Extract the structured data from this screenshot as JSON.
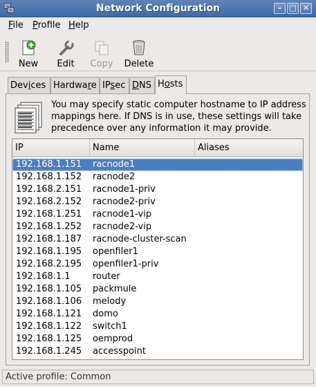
{
  "window": {
    "title": "Network Configuration"
  },
  "menu": {
    "file": "File",
    "profile": "Profile",
    "help": "Help"
  },
  "toolbar": {
    "new": "New",
    "edit": "Edit",
    "copy": "Copy",
    "delete": "Delete"
  },
  "tabs": [
    {
      "label": "Devices",
      "active": false
    },
    {
      "label": "Hardware",
      "active": false
    },
    {
      "label": "IPsec",
      "active": false
    },
    {
      "label": "DNS",
      "active": false
    },
    {
      "label": "Hosts",
      "active": true
    }
  ],
  "info_text": "You may specify static computer hostname to IP address mappings here.  If DNS is in use, these settings will take precedence over any information it may provide.",
  "table": {
    "columns": {
      "ip": "IP",
      "name": "Name",
      "aliases": "Aliases"
    },
    "rows": [
      {
        "ip": "192.168.1.151",
        "name": "racnode1",
        "aliases": "",
        "selected": true
      },
      {
        "ip": "192.168.1.152",
        "name": "racnode2",
        "aliases": ""
      },
      {
        "ip": "192.168.2.151",
        "name": "racnode1-priv",
        "aliases": ""
      },
      {
        "ip": "192.168.2.152",
        "name": "racnode2-priv",
        "aliases": ""
      },
      {
        "ip": "192.168.1.251",
        "name": "racnode1-vip",
        "aliases": ""
      },
      {
        "ip": "192.168.1.252",
        "name": "racnode2-vip",
        "aliases": ""
      },
      {
        "ip": "192.168.1.187",
        "name": "racnode-cluster-scan",
        "aliases": ""
      },
      {
        "ip": "192.168.1.195",
        "name": "openfiler1",
        "aliases": ""
      },
      {
        "ip": "192.168.2.195",
        "name": "openfiler1-priv",
        "aliases": ""
      },
      {
        "ip": "192.168.1.1",
        "name": "router",
        "aliases": ""
      },
      {
        "ip": "192.168.1.105",
        "name": "packmule",
        "aliases": ""
      },
      {
        "ip": "192.168.1.106",
        "name": "melody",
        "aliases": ""
      },
      {
        "ip": "192.168.1.121",
        "name": "domo",
        "aliases": ""
      },
      {
        "ip": "192.168.1.122",
        "name": "switch1",
        "aliases": ""
      },
      {
        "ip": "192.168.1.125",
        "name": "oemprod",
        "aliases": ""
      },
      {
        "ip": "192.168.1.245",
        "name": "accesspoint",
        "aliases": ""
      }
    ]
  },
  "status": {
    "text": "Active profile: Common"
  },
  "colors": {
    "titlebar": "#4a74ad",
    "selection": "#4b7ec2",
    "background": "#ece9e6"
  }
}
